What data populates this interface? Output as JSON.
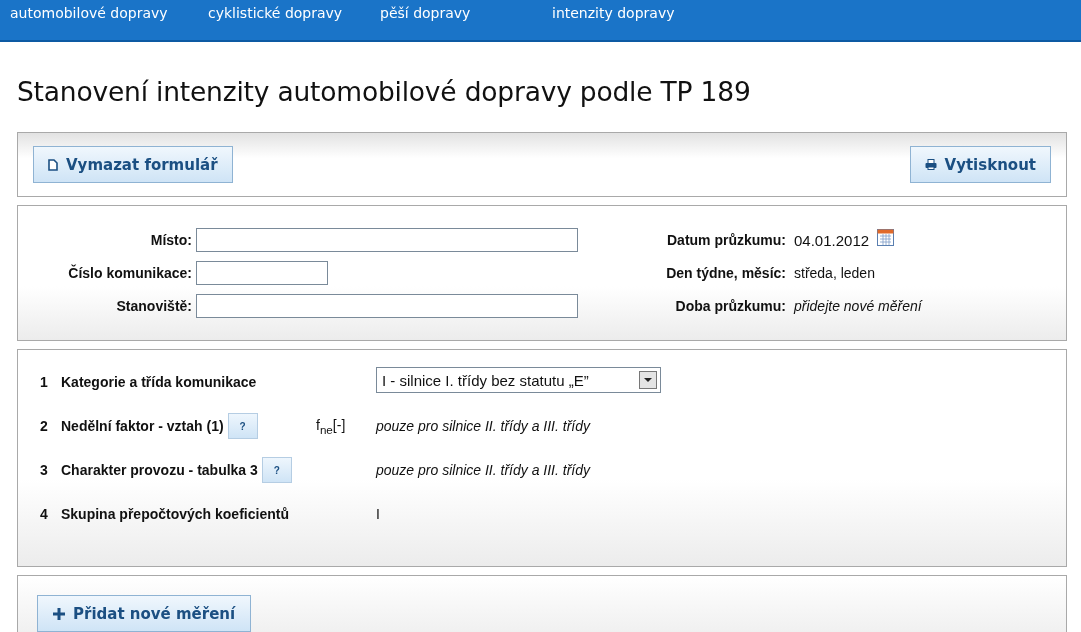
{
  "nav": {
    "items": [
      {
        "label": "automobilové dopravy"
      },
      {
        "label": "cyklistické dopravy"
      },
      {
        "label": "pěší dopravy"
      },
      {
        "label": "intenzity dopravy"
      }
    ]
  },
  "title": "Stanovení intenzity automobilové dopravy podle TP 189",
  "toolbar": {
    "clear_button": "Vymazat formulář",
    "print_button": "Vytisknout"
  },
  "form": {
    "left": [
      {
        "label": "Místo:"
      },
      {
        "label": "Číslo komunikace:"
      },
      {
        "label": "Stanoviště:"
      }
    ],
    "right": [
      {
        "label": "Datum průzkumu:",
        "value": "04.01.2012",
        "kind": "date"
      },
      {
        "label": "Den týdne, měsíc:",
        "value": "středa, leden",
        "kind": "text"
      },
      {
        "label": "Doba průzkumu:",
        "value": "přidejte nové měření",
        "kind": "hint"
      }
    ]
  },
  "params": [
    {
      "number": "1",
      "label": "Kategorie a třída komunikace",
      "kind": "select",
      "value": "I - silnice I. třídy bez statutu „E”"
    },
    {
      "number": "2",
      "label": "Nedělní faktor - vztah (1)",
      "kind": "note",
      "help": "?",
      "symbol": "f$_{ne}$[-]",
      "value": "pouze pro silnice II. třídy a III. třídy"
    },
    {
      "number": "3",
      "label": "Charakter provozu - tabulka 3",
      "kind": "note",
      "help": "?",
      "value": "pouze pro silnice II. třídy a III. třídy"
    },
    {
      "number": "4",
      "label": "Skupina přepočtových koeficientů",
      "kind": "text",
      "value": "I"
    }
  ],
  "add_button": "Přidat nové měření"
}
